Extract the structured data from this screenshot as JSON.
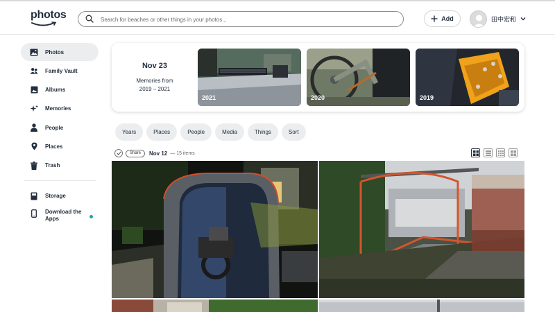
{
  "app": {
    "logo_text": "photos"
  },
  "search": {
    "placeholder": "Search for beaches or other things in your photos..."
  },
  "header": {
    "add_label": "Add",
    "account_name": "田中宏和"
  },
  "sidebar": {
    "items": [
      {
        "label": "Photos",
        "icon": "photos-icon",
        "active": true
      },
      {
        "label": "Family Vault",
        "icon": "people-group-icon"
      },
      {
        "label": "Albums",
        "icon": "albums-icon"
      },
      {
        "label": "Memories",
        "icon": "sparkle-icon"
      },
      {
        "label": "People",
        "icon": "person-icon"
      },
      {
        "label": "Places",
        "icon": "map-pin-icon"
      },
      {
        "label": "Trash",
        "icon": "trash-icon"
      }
    ],
    "storage_label": "Storage",
    "download_label_line1": "Download the",
    "download_label_line2": "Apps"
  },
  "memories": {
    "date": "Nov 23",
    "subtitle_line1": "Memories from",
    "subtitle_line2": "2019 – 2021",
    "cards": [
      {
        "year": "2021"
      },
      {
        "year": "2020"
      },
      {
        "year": "2019"
      }
    ]
  },
  "filters": [
    "Years",
    "Places",
    "People",
    "Media",
    "Things",
    "Sort"
  ],
  "day": {
    "share_label": "Share",
    "date": "Nov 12",
    "count": "— 15 items"
  },
  "colors": {
    "accent_dot": "#24a19c",
    "chip_bg": "#ebedef",
    "text": "#232f3e"
  }
}
